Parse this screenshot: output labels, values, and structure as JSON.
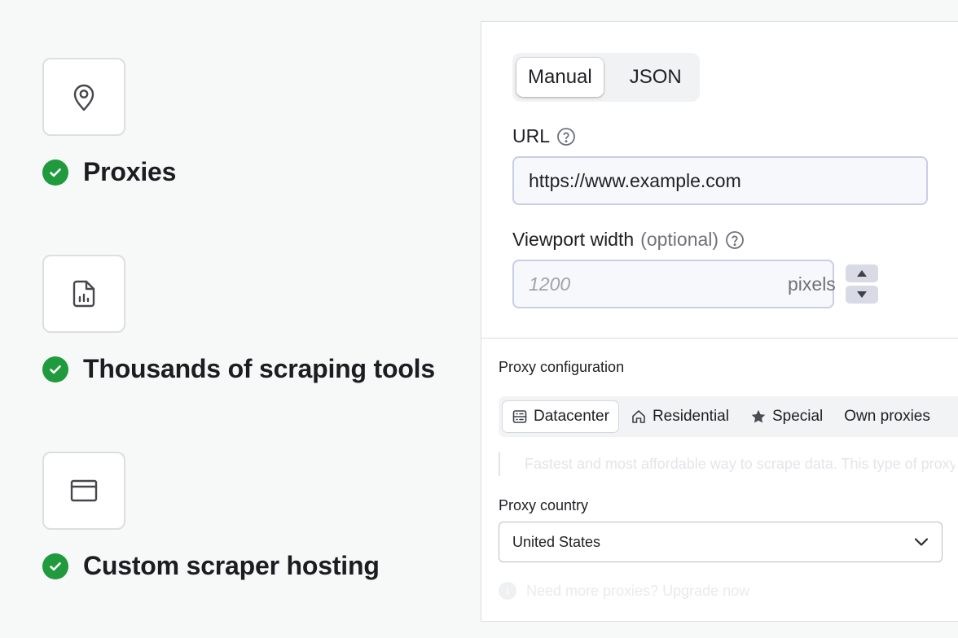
{
  "features": [
    {
      "icon": "map-pin-icon",
      "label": "Proxies"
    },
    {
      "icon": "file-chart-icon",
      "label": "Thousands of scraping tools"
    },
    {
      "icon": "browser-window-icon",
      "label": "Custom scraper hosting"
    }
  ],
  "colors": {
    "check_green": "#1f9a3c",
    "input_border": "#c9cde8",
    "stepper_bg": "#d8dbe6"
  },
  "mode_toggle": {
    "manual_label": "Manual",
    "json_label": "JSON",
    "selected": "Manual"
  },
  "url_field": {
    "label": "URL",
    "value": "https://www.example.com"
  },
  "viewport_field": {
    "label": "Viewport width",
    "optional_label": "(optional)",
    "placeholder": "1200",
    "unit": "pixels"
  },
  "proxy_config": {
    "title": "Proxy configuration",
    "tabs": [
      {
        "label": "Datacenter",
        "icon": "server-icon"
      },
      {
        "label": "Residential",
        "icon": "house-icon"
      },
      {
        "label": "Special",
        "icon": "star-icon"
      },
      {
        "label": "Own proxies",
        "icon": ""
      }
    ],
    "selected_tab": "Datacenter",
    "description": "Fastest and most affordable way to scrape data. This type of proxy is shared."
  },
  "proxy_country": {
    "label": "Proxy country",
    "value": "United States"
  },
  "upgrade_note": {
    "text": "Need more proxies? Upgrade now"
  }
}
